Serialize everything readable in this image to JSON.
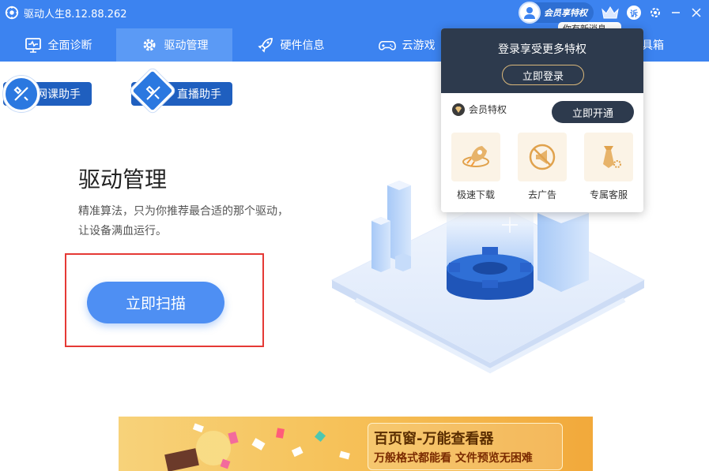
{
  "app": {
    "title": "驱动人生8.12.88.262"
  },
  "header": {
    "vip_label": "会员享特权",
    "su_badge": "诉",
    "tooltip_peek": "你有新消息"
  },
  "tabs": [
    {
      "label": "全面诊断",
      "icon": "monitor-icon"
    },
    {
      "label": "驱动管理",
      "icon": "gear-icon",
      "active": true
    },
    {
      "label": "硬件信息",
      "icon": "rocket-icon"
    },
    {
      "label": "云游戏",
      "icon": "gamepad-icon"
    }
  ],
  "tab_partial": "具箱",
  "helpers": [
    {
      "label": "网课助手"
    },
    {
      "label": "直播助手"
    }
  ],
  "main": {
    "title": "驱动管理",
    "description_line1": "精准算法，只为你推荐最合适的那个驱动，",
    "description_line2": "让设备满血运行。",
    "scan_button": "立即扫描"
  },
  "popup": {
    "title": "登录享受更多特权",
    "login_button": "立即登录",
    "vip_privilege_label": "会员特权",
    "open_button": "立即开通",
    "perks": [
      {
        "label": "极速下载",
        "icon": "rocket-icon"
      },
      {
        "label": "去广告",
        "icon": "no-ads-icon"
      },
      {
        "label": "专属客服",
        "icon": "tie-icon"
      }
    ]
  },
  "banner": {
    "title": "百页窗-万能查看器",
    "subtitle": "万般格式都能看 文件预览无困难"
  },
  "colors": {
    "brand_blue": "#3c83f0",
    "active_tab": "#5b9af5",
    "popup_dark": "#2d3a4d",
    "highlight_red": "#e53935"
  }
}
